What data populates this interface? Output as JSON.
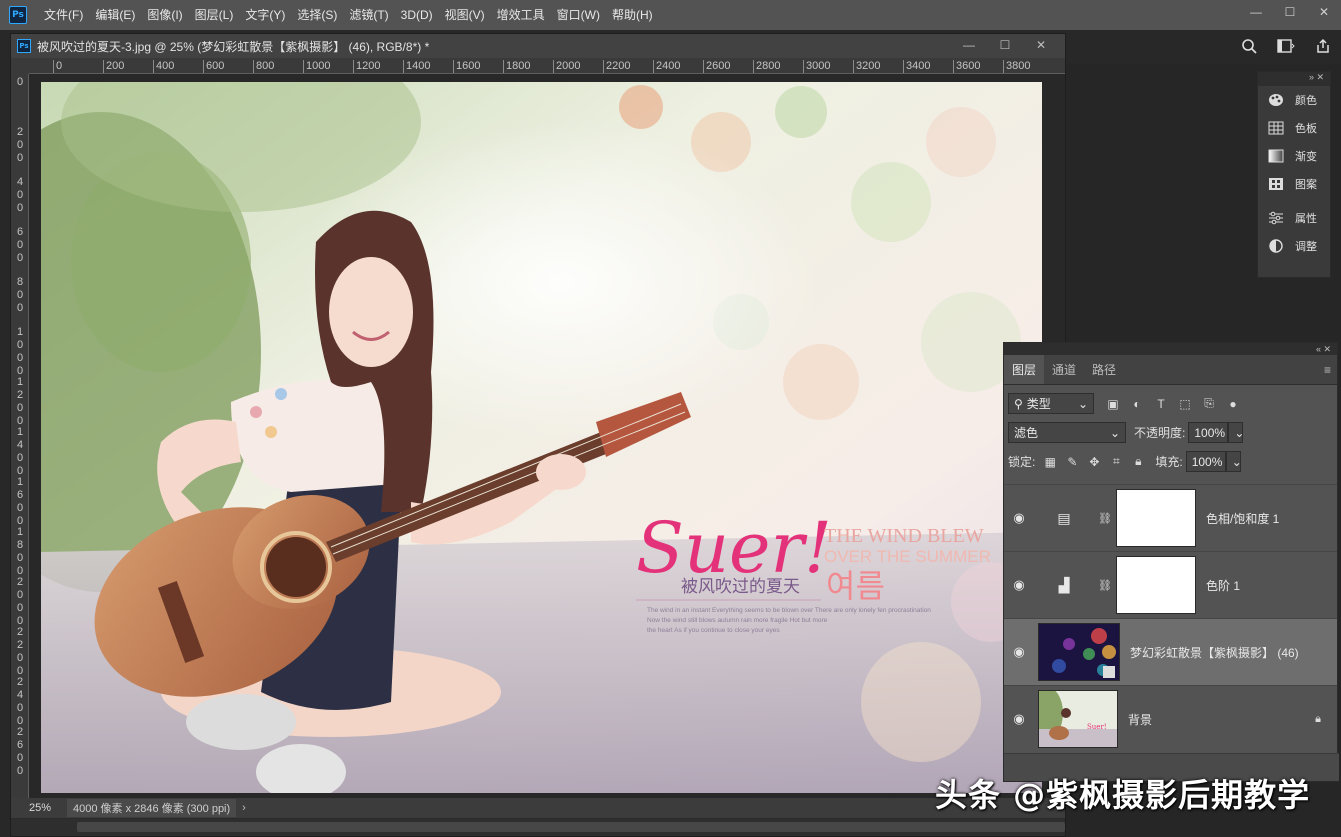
{
  "app": {
    "logo": "Ps"
  },
  "menu": [
    "文件(F)",
    "编辑(E)",
    "图像(I)",
    "图层(L)",
    "文字(Y)",
    "选择(S)",
    "滤镜(T)",
    "3D(D)",
    "视图(V)",
    "增效工具",
    "窗口(W)",
    "帮助(H)"
  ],
  "document": {
    "tab_title": "被风吹过的夏天-3.jpg @ 25% (梦幻彩虹散景【紫枫摄影】 (46), RGB/8*) *",
    "zoom": "25%",
    "size_info": "4000 像素 x 2846 像素 (300 ppi)"
  },
  "ruler_h": [
    "0",
    "200",
    "400",
    "600",
    "800",
    "1000",
    "1200",
    "1400",
    "1600",
    "1800",
    "2000",
    "2200",
    "2400",
    "2600",
    "2800",
    "3000",
    "3200",
    "3400",
    "3600",
    "3800"
  ],
  "ruler_v": [
    "0",
    "200",
    "400",
    "600",
    "800",
    "1000",
    "1200",
    "1400",
    "1600",
    "1800",
    "2000",
    "2200",
    "2400",
    "2600"
  ],
  "artwork": {
    "headline": "Suer!",
    "line1": "THE WIND BLEW",
    "line2": "OVER THE SUMMER",
    "cn_title": "被风吹过的夏天",
    "kr_title": "여름",
    "small1": "The wind in an instant Everything seems to be blown over There are only lonely fen procrastination",
    "small2": "Now the wind still blows autumn rain more fragile Hot but more",
    "small3": "the heart As if you continue to close your eyes"
  },
  "float_panel": {
    "items": [
      {
        "label": "颜色",
        "icon": "palette-icon"
      },
      {
        "label": "色板",
        "icon": "swatches-icon"
      },
      {
        "label": "渐变",
        "icon": "gradient-icon"
      },
      {
        "label": "图案",
        "icon": "pattern-icon"
      },
      {
        "label": "属性",
        "icon": "properties-icon"
      },
      {
        "label": "调整",
        "icon": "adjustments-icon"
      }
    ]
  },
  "layers_panel": {
    "tabs": [
      "图层",
      "通道",
      "路径"
    ],
    "filter_label": "类型",
    "blend_mode": "滤色",
    "opacity_label": "不透明度:",
    "opacity_value": "100%",
    "lock_label": "锁定:",
    "fill_label": "填充:",
    "fill_value": "100%",
    "layers": [
      {
        "name": "色相/饱和度 1",
        "kind": "hue-sat"
      },
      {
        "name": "色阶 1",
        "kind": "levels"
      },
      {
        "name": "梦幻彩虹散景【紫枫摄影】 (46)",
        "kind": "smart"
      },
      {
        "name": "背景",
        "kind": "background"
      }
    ]
  },
  "watermark": "头条 @紫枫摄影后期教学"
}
